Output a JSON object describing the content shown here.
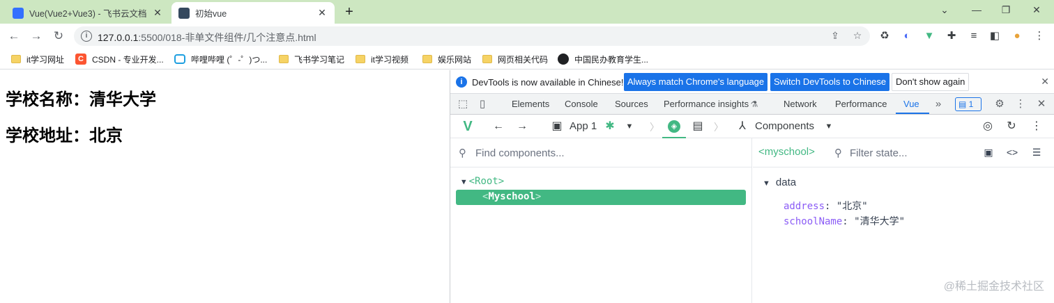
{
  "browser": {
    "tabs": [
      {
        "title": "Vue(Vue2+Vue3) - 飞书云文档",
        "active": false,
        "favicon": "doc-icon"
      },
      {
        "title": "初始vue",
        "active": true,
        "favicon": "vue-icon"
      }
    ],
    "new_tab": "+",
    "window_controls": [
      "⌄",
      "—",
      "❐",
      "✕"
    ],
    "url_host": "127.0.0.1",
    "url_path": ":5500/018-非单文件组件/几个注意点.html",
    "bookmarks": [
      {
        "label": "it学习网址",
        "icon": "folder-icon"
      },
      {
        "label": "CSDN - 专业开发...",
        "icon": "csdn-icon"
      },
      {
        "label": "哔哩哔哩 (゜-゜)つ...",
        "icon": "bilibili-icon"
      },
      {
        "label": "飞书学习笔记",
        "icon": "folder-icon"
      },
      {
        "label": "it学习视频",
        "icon": "folder-icon"
      },
      {
        "label": "娱乐网站",
        "icon": "folder-icon"
      },
      {
        "label": "网页相关代码",
        "icon": "folder-icon"
      },
      {
        "label": "中国民办教育学生...",
        "icon": "globe-icon"
      }
    ]
  },
  "page": {
    "school_name": "学校名称：清华大学",
    "school_address": "学校地址：北京"
  },
  "devtools": {
    "infobar": {
      "message": "DevTools is now available in Chinese!",
      "btn_match": "Always match Chrome's language",
      "btn_switch": "Switch DevTools to Chinese",
      "btn_dismiss": "Don't show again"
    },
    "tabs": [
      "Elements",
      "Console",
      "Sources",
      "Performance insights",
      "Network",
      "Performance",
      "Vue"
    ],
    "active_tab": "Vue",
    "issues_count": "1",
    "vue": {
      "app_label": "App 1",
      "components_label": "Components",
      "search_placeholder": "Find components...",
      "root_tag": "<Root>",
      "selected_name": "Myschool",
      "inspected_component": "<myschool>",
      "filter_placeholder": "Filter state...",
      "section": "data",
      "state": [
        {
          "key": "address",
          "value": "\"北京\""
        },
        {
          "key": "schoolName",
          "value": "\"清华大学\""
        }
      ]
    }
  },
  "watermark": "@稀土掘金技术社区",
  "colors": {
    "vue_green": "#42b883",
    "chrome_blue": "#1a73e8",
    "tabstrip": "#cde7c1"
  }
}
